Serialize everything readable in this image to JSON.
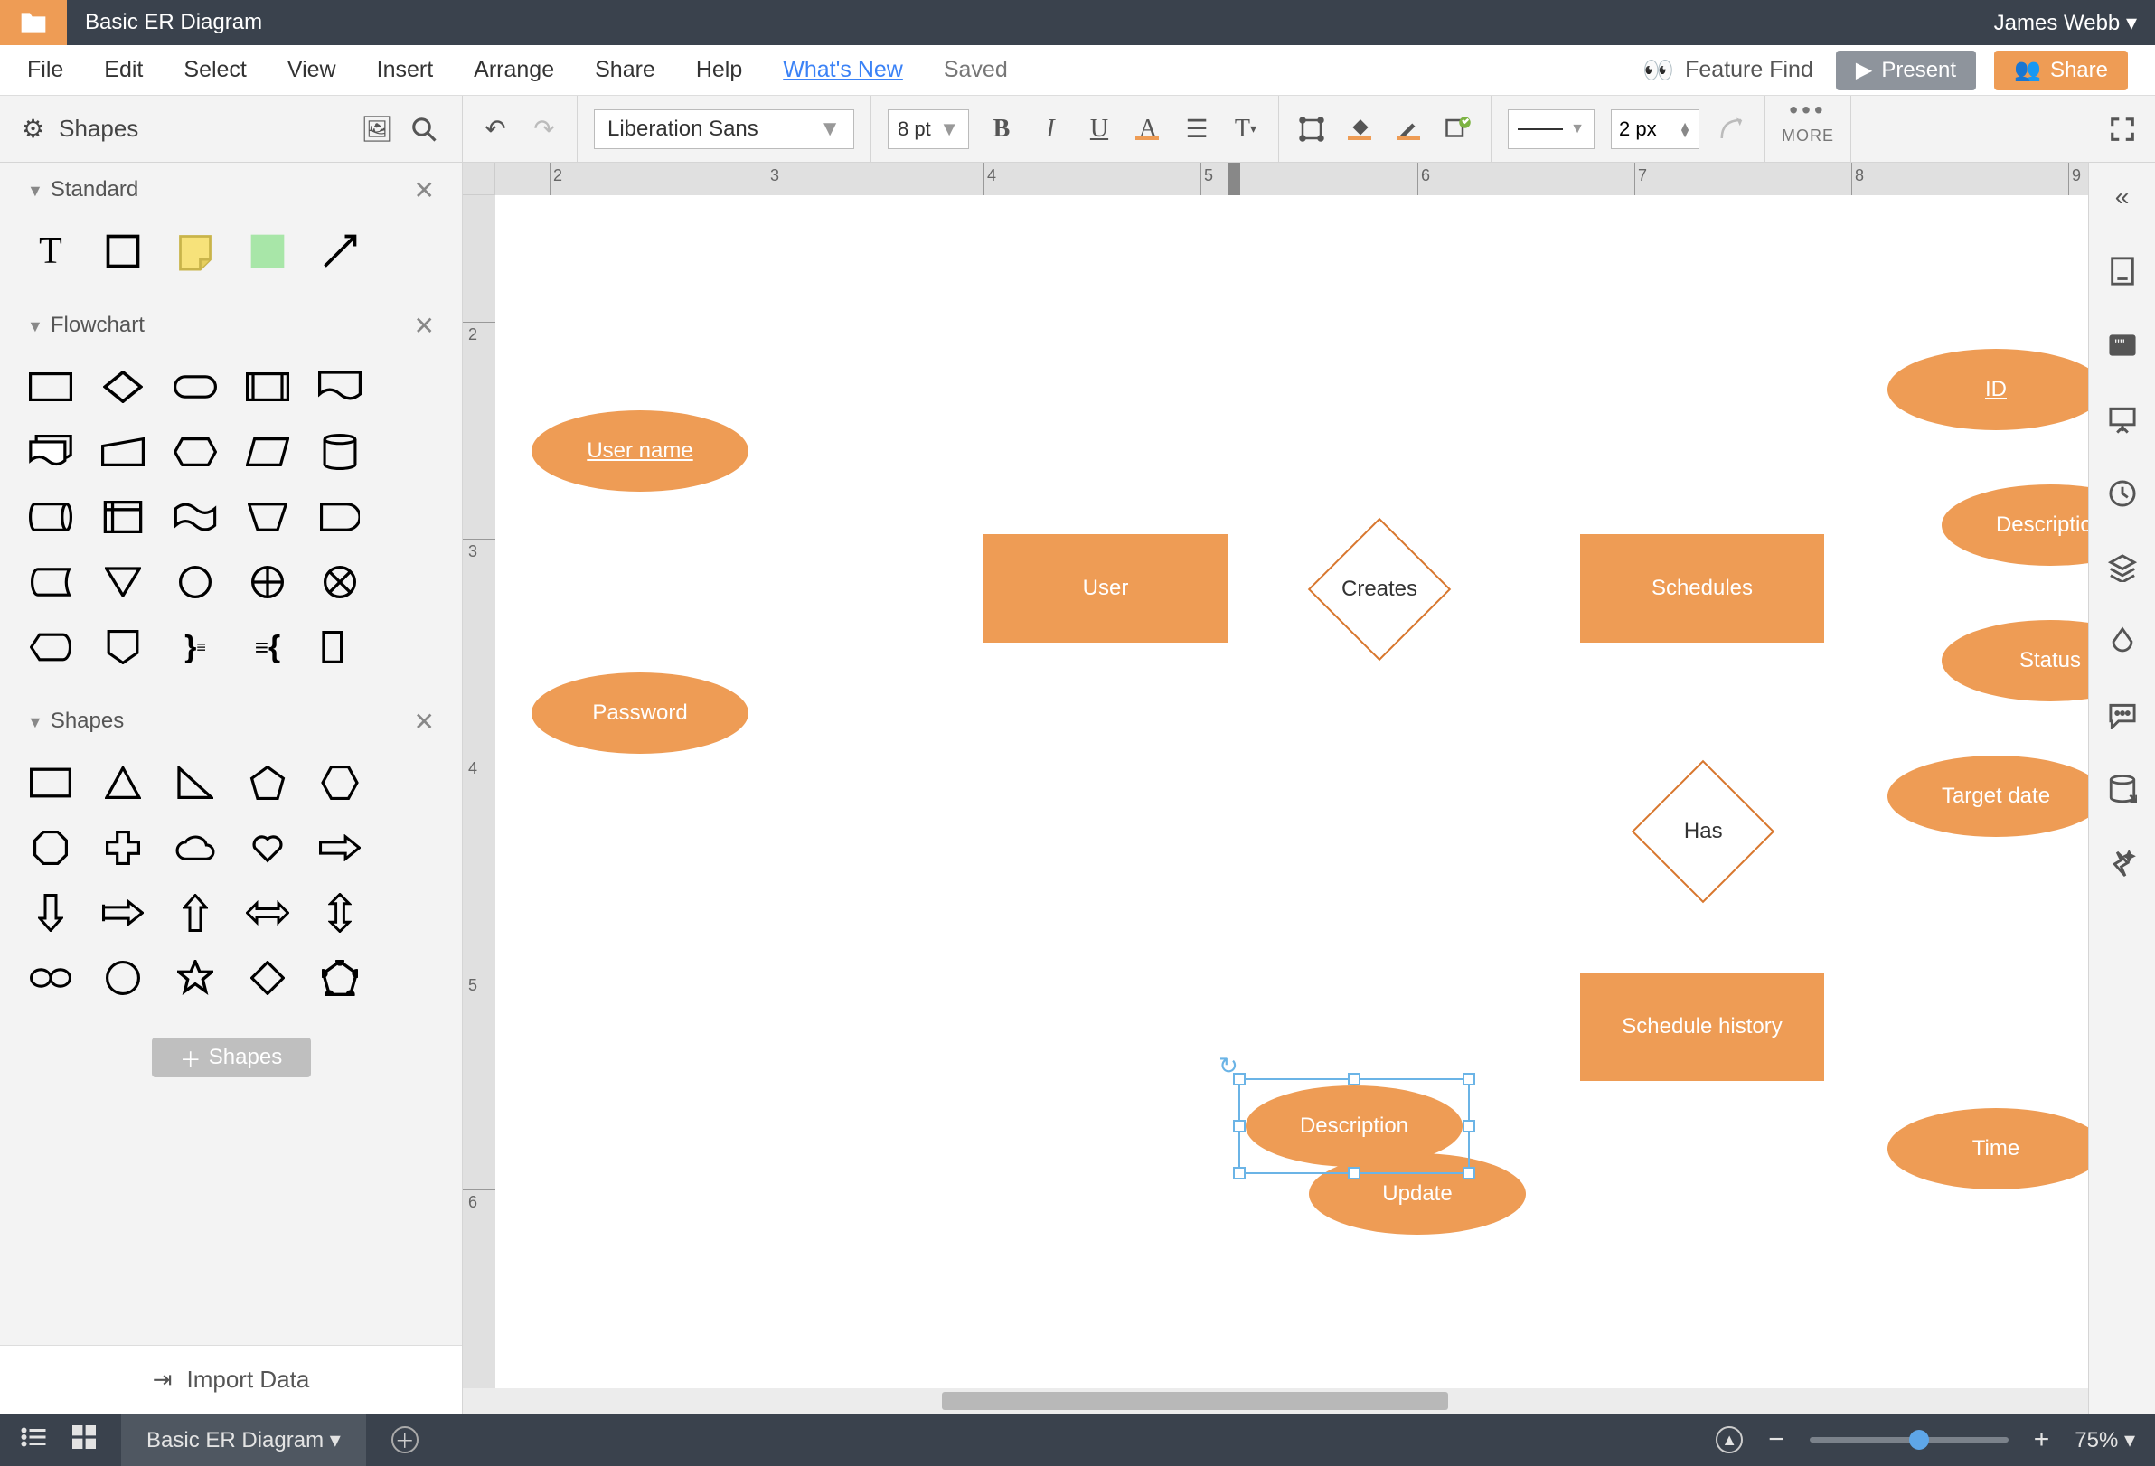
{
  "header": {
    "doc_title": "Basic ER Diagram",
    "user": "James Webb ▾"
  },
  "menu": {
    "file": "File",
    "edit": "Edit",
    "select": "Select",
    "view": "View",
    "insert": "Insert",
    "arrange": "Arrange",
    "share": "Share",
    "help": "Help",
    "whatsnew": "What's New",
    "saved": "Saved",
    "feature_find": "Feature Find",
    "present": "Present",
    "sharebtn": "Share"
  },
  "toolbar": {
    "shapes_label": "Shapes",
    "font": "Liberation Sans",
    "font_size": "8 pt",
    "line_px": "2 px",
    "more": "MORE"
  },
  "left": {
    "cat_standard": "Standard",
    "cat_flowchart": "Flowchart",
    "cat_shapes": "Shapes",
    "add_shapes": "Shapes",
    "import": "Import Data"
  },
  "canvas": {
    "user": "User",
    "creates": "Creates",
    "schedules": "Schedules",
    "username": "User name",
    "password": "Password",
    "id": "ID",
    "description": "Description",
    "status": "Status",
    "targetdate": "Target date",
    "has": "Has",
    "sched_history": "Schedule history",
    "desc2": "Description",
    "update": "Update",
    "time": "Time"
  },
  "footer": {
    "tab": "Basic ER Diagram ▾",
    "zoom": "75% ▾"
  },
  "ruler": {
    "h": [
      "2",
      "3",
      "4",
      "5",
      "6",
      "7",
      "8",
      "9"
    ],
    "v": [
      "2",
      "3",
      "4",
      "5",
      "6"
    ]
  }
}
